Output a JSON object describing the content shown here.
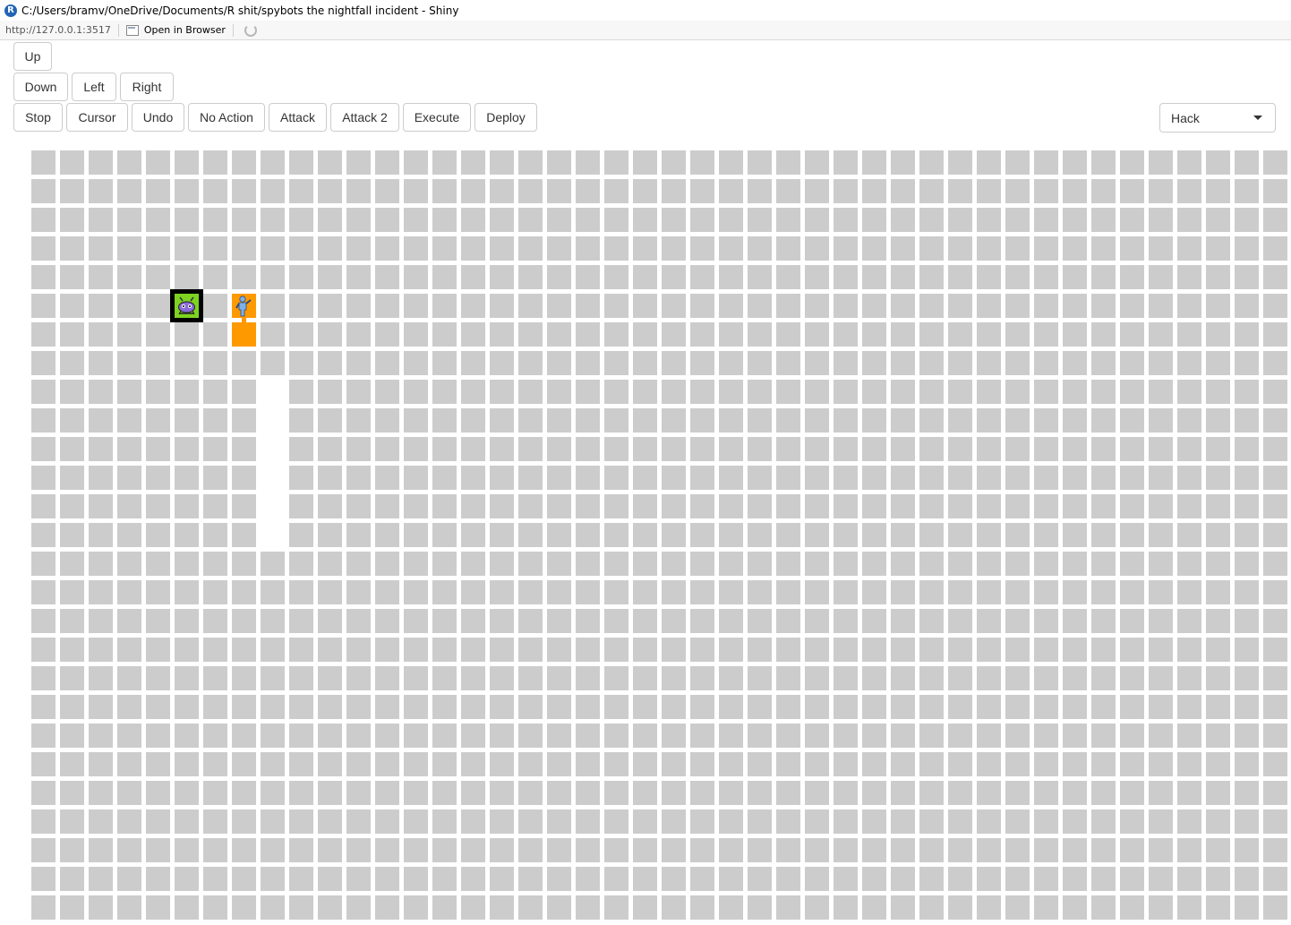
{
  "window": {
    "icon_letter": "R",
    "title": "C:/Users/bramv/OneDrive/Documents/R shit/spybots the nightfall incident - Shiny"
  },
  "addressbar": {
    "url": "http://127.0.0.1:3517",
    "open_in_browser": "Open in Browser"
  },
  "controls": {
    "up": "Up",
    "down": "Down",
    "left": "Left",
    "right": "Right",
    "stop": "Stop",
    "cursor": "Cursor",
    "undo": "Undo",
    "no_action": "No Action",
    "attack": "Attack",
    "attack2": "Attack 2",
    "execute": "Execute",
    "deploy": "Deploy"
  },
  "program_select": {
    "selected": "Hack"
  },
  "board": {
    "columns": 44,
    "rows": 27,
    "colors": {
      "tile": "#cccccc",
      "empty": "#ffffff",
      "unit_body": "#ff9900",
      "enemy_border": "#000000",
      "enemy_fill": "#7ed321"
    },
    "empty_cells": [
      {
        "col": 8,
        "row": 8
      },
      {
        "col": 8,
        "row": 9
      },
      {
        "col": 8,
        "row": 10
      },
      {
        "col": 8,
        "row": 11
      },
      {
        "col": 8,
        "row": 12
      },
      {
        "col": 8,
        "row": 13
      }
    ],
    "player_unit": {
      "icon": "hacker-person-icon",
      "head": {
        "col": 7,
        "row": 5
      },
      "body": [
        {
          "col": 7,
          "row": 6
        }
      ]
    },
    "enemy_unit": {
      "icon": "sentinel-bug-icon",
      "cell": {
        "col": 5,
        "row": 5
      }
    }
  }
}
